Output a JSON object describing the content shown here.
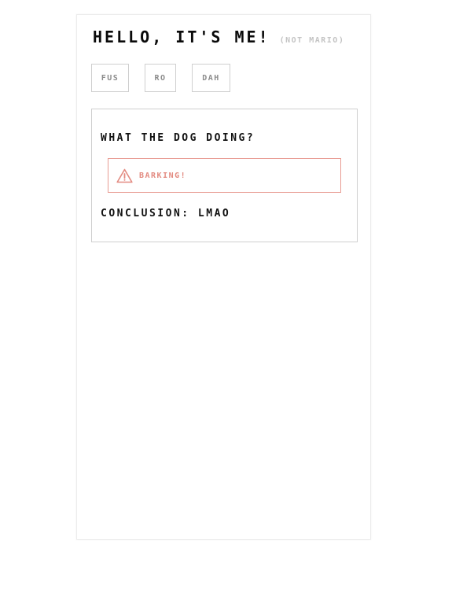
{
  "header": {
    "title": "HELLO, IT'S ME!",
    "subtitle": "(NOT MARIO)"
  },
  "buttons": [
    {
      "label": "FUS"
    },
    {
      "label": "RO"
    },
    {
      "label": "DAH"
    }
  ],
  "panel": {
    "question": "WHAT THE DOG DOING?",
    "alert": {
      "icon": "warning-icon",
      "text": "BARKING!",
      "color": "#e38b81"
    },
    "conclusion": "CONCLUSION: LMAO"
  }
}
